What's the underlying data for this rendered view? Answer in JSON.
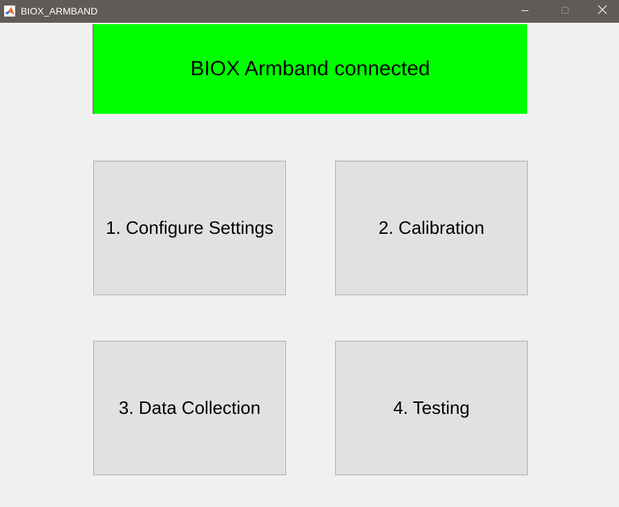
{
  "window": {
    "title": "BIOX_ARMBAND",
    "app_icon": "matlab-icon",
    "controls": {
      "minimize_icon": "minimize-icon",
      "maximize_icon": "maximize-icon",
      "close_icon": "close-icon"
    }
  },
  "status": {
    "text": "BIOX Armband connected",
    "color": "#00ff00"
  },
  "buttons": [
    {
      "label": "1. Configure Settings"
    },
    {
      "label": "2. Calibration"
    },
    {
      "label": "3. Data Collection"
    },
    {
      "label": "4. Testing"
    }
  ]
}
